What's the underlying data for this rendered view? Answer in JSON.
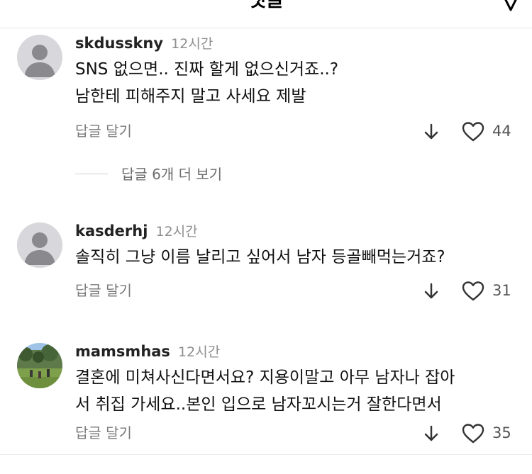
{
  "header": {
    "title": "댓글"
  },
  "comments": [
    {
      "username": "skdusskny",
      "time": "12시간",
      "lines": [
        "SNS 없으면.. 진짜 할게 없으신거죠..?",
        "남한테 피해주지 말고 사세요 제발"
      ],
      "reply_label": "답글 달기",
      "likes": "44",
      "more_replies": "답글 6개 더 보기"
    },
    {
      "username": "kasderhj",
      "time": "12시간",
      "lines": [
        "솔직히 그냥 이름 날리고 싶어서 남자 등골빼먹는거죠?"
      ],
      "reply_label": "답글 달기",
      "likes": "31"
    },
    {
      "username": "mamsmhas",
      "time": "12시간",
      "lines": [
        "결혼에 미쳐사신다면서요? 지용이말고 아무 남자나 잡아",
        "서 취집 가세요..본인 입으로 남자꼬시는거 잘한다면서"
      ],
      "reply_label": "답글 달기",
      "likes": "35"
    }
  ],
  "icons": {
    "close": "chevron-down-icon",
    "avatar": "default-avatar-icon",
    "downvote": "arrow-down-icon",
    "like": "heart-outline-icon"
  },
  "colors": {
    "username": "#222222",
    "muted": "#8e8e8e",
    "divider": "#e6e6e6"
  }
}
